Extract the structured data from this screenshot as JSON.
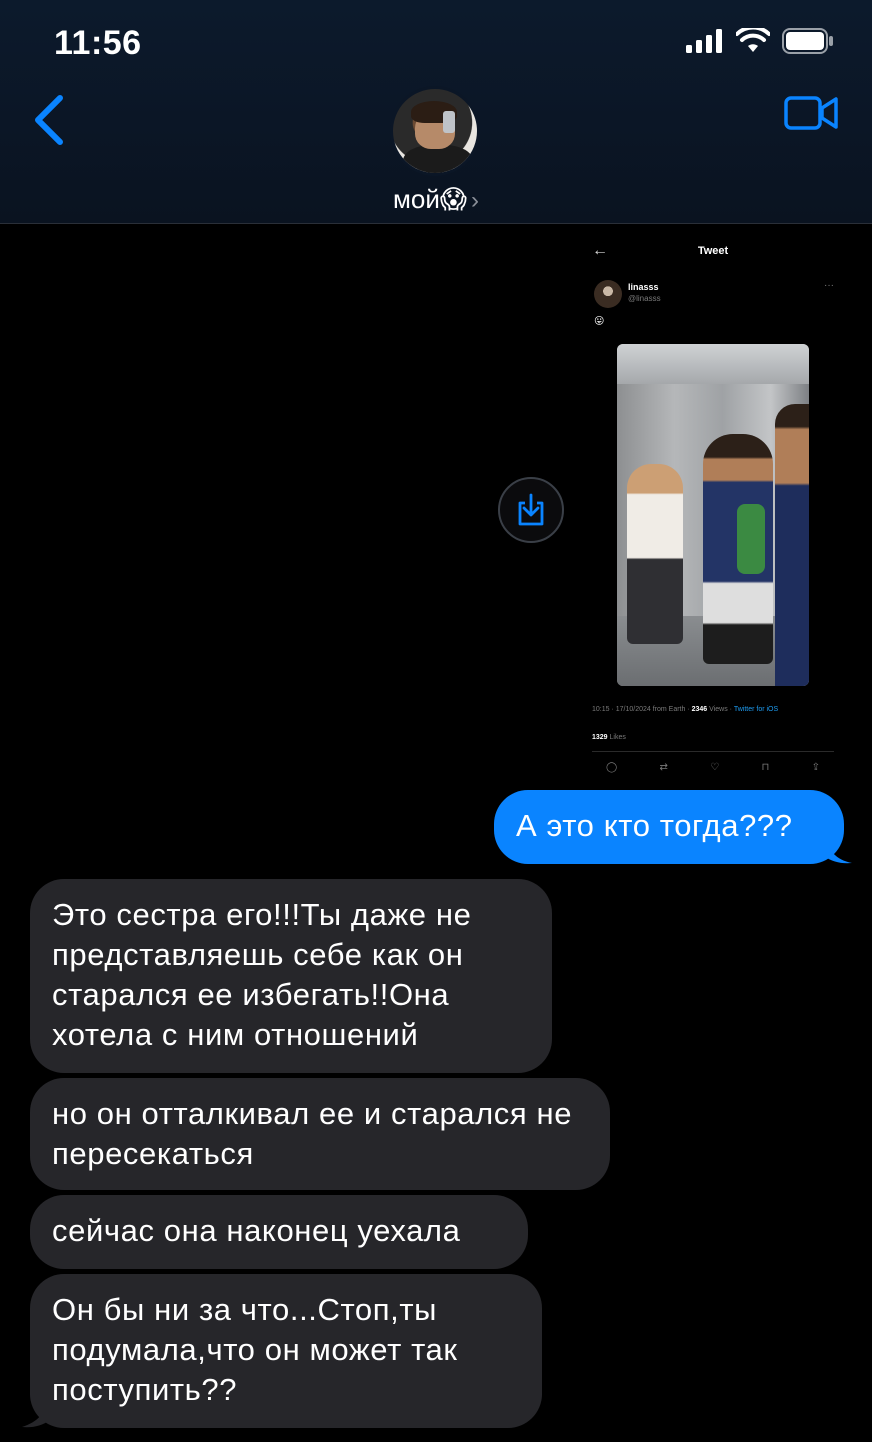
{
  "status_bar": {
    "time": "11:56"
  },
  "header": {
    "contact_name": "мой😱",
    "chevron": "›"
  },
  "tweet": {
    "back_glyph": "←",
    "title": "Tweet",
    "name": "linasss",
    "handle": "@linasss",
    "more": "···",
    "emoji": "😛",
    "meta_time": "10:15 · 17/10/2024 from Earth ·",
    "meta_views_count": "2346",
    "meta_views_label": "Views ·",
    "meta_source": "Twitter for iOS",
    "likes_count": "1329",
    "likes_label": "Likes",
    "actions": [
      "◯",
      "⇄",
      "♡",
      "⊓",
      "⇪"
    ]
  },
  "messages": {
    "outgoing_1": "А это кто тогда???",
    "incoming_1": "Это сестра его!!!Ты даже не представляешь себе как он старался ее избегать!!Она хотела с ним отношений",
    "incoming_2": "но он отталкивал ее и старался не пересекаться",
    "incoming_3": "сейчас она наконец уехала",
    "incoming_4": "Он бы ни за что...Стоп,ты подумала,что он может так поступить??"
  },
  "colors": {
    "accent": "#0a84ff",
    "incoming_bubble": "#26262a",
    "header_bg": "#0b1626"
  }
}
